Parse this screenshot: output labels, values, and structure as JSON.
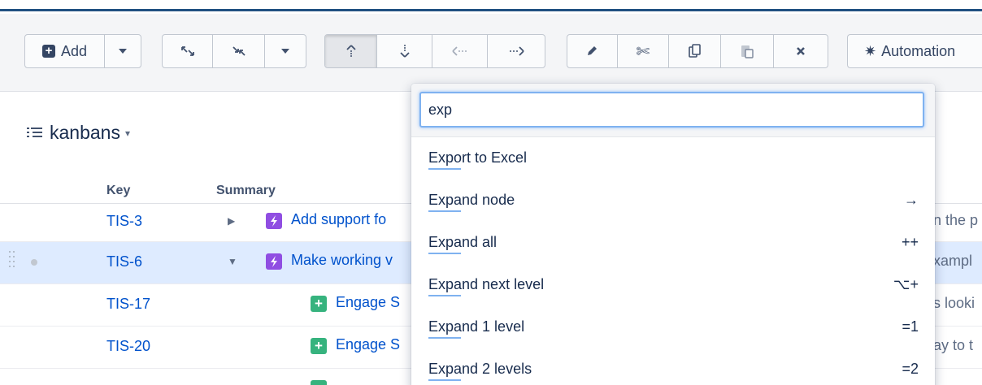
{
  "toolbar": {
    "add_label": "Add",
    "automation_label": "Automation"
  },
  "structure": {
    "title": "kanbans"
  },
  "table": {
    "headers": {
      "key": "Key",
      "summary": "Summary"
    },
    "rows": [
      {
        "key": "TIS-3",
        "summary": "Add support fo",
        "right_text": "n the p",
        "type": "epic",
        "expanded": false
      },
      {
        "key": "TIS-6",
        "summary": "Make working v",
        "right_text": "xampl",
        "type": "epic",
        "expanded": true,
        "selected": true
      },
      {
        "key": "TIS-17",
        "summary": "Engage S",
        "right_text": "s looki",
        "type": "story"
      },
      {
        "key": "TIS-20",
        "summary": "Engage S",
        "right_text": "ay to t",
        "type": "story"
      }
    ]
  },
  "popup": {
    "search_value": "exp",
    "items": [
      {
        "label": "Export to Excel",
        "shortcut": ""
      },
      {
        "label": "Expand node",
        "shortcut": "→"
      },
      {
        "label": "Expand all",
        "shortcut": "++"
      },
      {
        "label": "Expand next level",
        "shortcut": "⌥+"
      },
      {
        "label": "Expand 1 level",
        "shortcut": "=1"
      },
      {
        "label": "Expand 2 levels",
        "shortcut": "=2"
      }
    ]
  }
}
